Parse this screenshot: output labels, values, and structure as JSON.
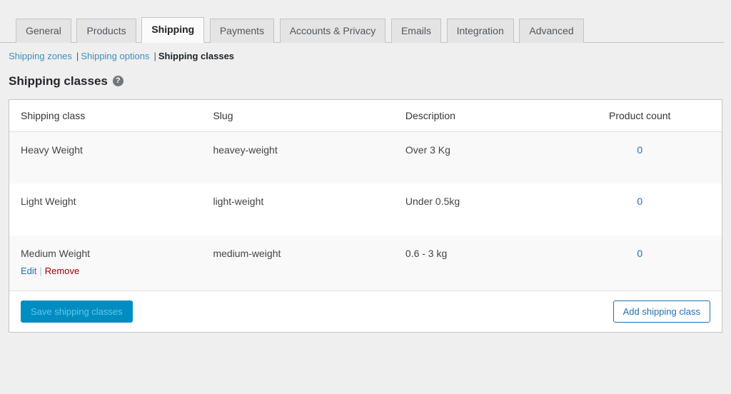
{
  "tabs": [
    {
      "label": "General",
      "active": false
    },
    {
      "label": "Products",
      "active": false
    },
    {
      "label": "Shipping",
      "active": true
    },
    {
      "label": "Payments",
      "active": false
    },
    {
      "label": "Accounts & Privacy",
      "active": false
    },
    {
      "label": "Emails",
      "active": false
    },
    {
      "label": "Integration",
      "active": false
    },
    {
      "label": "Advanced",
      "active": false
    }
  ],
  "subnav": {
    "separator": "|",
    "items": [
      {
        "label": "Shipping zones",
        "current": false
      },
      {
        "label": "Shipping options",
        "current": false
      },
      {
        "label": "Shipping classes",
        "current": true
      }
    ]
  },
  "page": {
    "title": "Shipping classes",
    "help_icon": "?"
  },
  "table": {
    "columns": {
      "shipping_class": "Shipping class",
      "slug": "Slug",
      "description": "Description",
      "product_count": "Product count"
    },
    "rows": [
      {
        "shipping_class": "Heavy Weight",
        "slug": "heavey-weight",
        "description": "Over 3 Kg",
        "product_count": "0"
      },
      {
        "shipping_class": "Light Weight",
        "slug": "light-weight",
        "description": "Under 0.5kg",
        "product_count": "0"
      },
      {
        "shipping_class": "Medium Weight",
        "slug": "medium-weight",
        "description": "0.6 - 3 kg",
        "product_count": "0"
      }
    ],
    "row_actions": {
      "edit": "Edit",
      "separator": "|",
      "remove": "Remove"
    }
  },
  "footer": {
    "save_label": "Save shipping classes",
    "add_label": "Add shipping class"
  },
  "colors": {
    "page_bg": "#efefef",
    "tab_inactive_bg": "#e4e4e4",
    "tab_active_bg": "#fbfbfb",
    "subnav_link_blue": "#3991be",
    "action_link_blue": "#2271b1",
    "remove_red": "#a00000",
    "row_alt_bg": "#f9f9f9",
    "save_button_bg": "#008ec2",
    "save_button_text": "#66c6e4",
    "add_button_border": "#2271b1"
  }
}
